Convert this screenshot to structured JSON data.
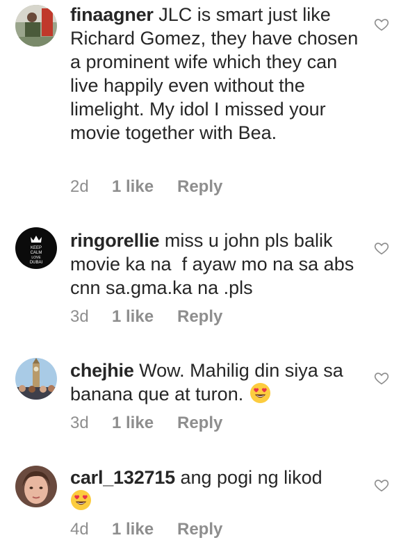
{
  "comments": [
    {
      "username": "finaagner",
      "text": "JLC is smart just like Richard Gomez, they have chosen a prominent wife which they can live happily even without the limelight. My idol I missed your movie together with Bea.",
      "time": "2d",
      "likes": "1 like",
      "reply": "Reply",
      "avatar": "person-photo"
    },
    {
      "username": "ringorellie",
      "text": "miss u john pls balik movie ka na  f ayaw mo na sa abs cnn sa.gma.ka na .pls",
      "time": "3d",
      "likes": "1 like",
      "reply": "Reply",
      "avatar": "keep-calm-crown",
      "avatar_text": [
        "KEEP",
        "CALM",
        "LOVE",
        "DUBAI"
      ]
    },
    {
      "username": "chejhie",
      "text": "Wow. Mahilig din siya sa banana que at turon.",
      "time": "3d",
      "likes": "1 like",
      "reply": "Reply",
      "avatar": "clock-tower-photo",
      "emoji": "heart-eyes"
    },
    {
      "username": "carl_132715",
      "text": "ang pogi ng likod",
      "time": "4d",
      "likes": "1 like",
      "reply": "Reply",
      "avatar": "selfie-photo",
      "emoji": "heart-eyes"
    }
  ],
  "colors": {
    "text": "#262626",
    "meta": "#8e8e8e",
    "heart_outline": "#8e8e8e",
    "emoji_face": "#fccc3f",
    "emoji_heart": "#e8334a"
  }
}
